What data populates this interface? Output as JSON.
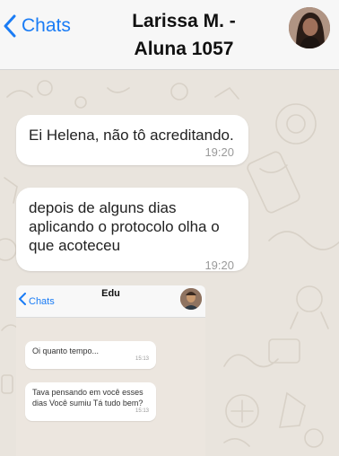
{
  "header": {
    "back_label": "Chats",
    "title_line1": "Larissa M. -",
    "title_line2": "Aluna 1057",
    "accent": "#1a7cf5"
  },
  "messages": [
    {
      "text": "Ei Helena, não tô acreditando.",
      "time": "19:20"
    },
    {
      "text": "depois de alguns dias aplicando o protocolo olha o que acoteceu",
      "time": "19:20"
    }
  ],
  "screenshot": {
    "back_label": "Chats",
    "title": "Edu",
    "messages": [
      {
        "text": "Oi quanto tempo...",
        "time": "15:13"
      },
      {
        "text": "Tava pensando em você esses dias Você sumiu Tá tudo bem?",
        "time": "15:13"
      }
    ]
  }
}
